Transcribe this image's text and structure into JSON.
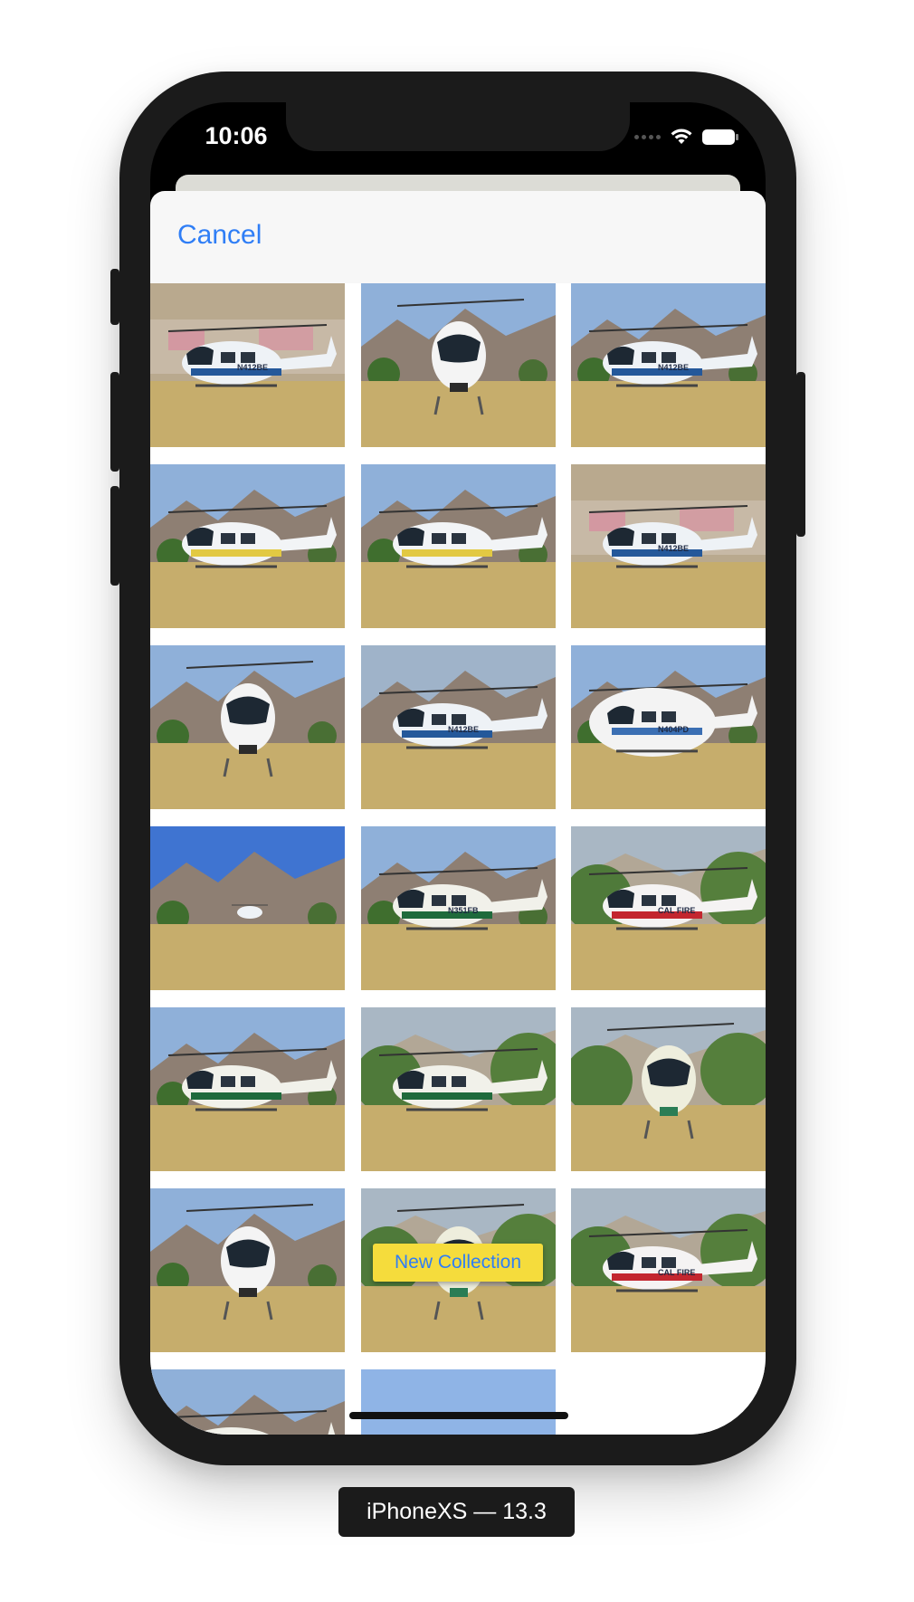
{
  "status_bar": {
    "time": "10:06",
    "icons": [
      "signal-dots-icon",
      "wifi-icon",
      "battery-icon"
    ]
  },
  "sheet": {
    "cancel_label": "Cancel"
  },
  "photos": [
    {
      "scene": "graffiti",
      "heli": "blue-white-side",
      "label": "N412BE"
    },
    {
      "scene": "mountain",
      "heli": "white-front",
      "label": ""
    },
    {
      "scene": "mountain",
      "heli": "blue-white-side",
      "label": "N412BE"
    },
    {
      "scene": "mountain",
      "heli": "white-yellow-side",
      "label": ""
    },
    {
      "scene": "mountain",
      "heli": "white-yellow-side",
      "label": ""
    },
    {
      "scene": "graffiti",
      "heli": "blue-white-side",
      "label": "N412BE"
    },
    {
      "scene": "mountain",
      "heli": "white-front",
      "label": ""
    },
    {
      "scene": "dusty",
      "heli": "blue-white-side",
      "label": "N412BE"
    },
    {
      "scene": "mountain",
      "heli": "white-side-large",
      "label": "N404PD"
    },
    {
      "scene": "open-field",
      "heli": "small-distant",
      "label": ""
    },
    {
      "scene": "mountain",
      "heli": "green-white-side",
      "label": "N351FB"
    },
    {
      "scene": "trees",
      "heli": "red-white-side",
      "label": "CAL FIRE"
    },
    {
      "scene": "mountain",
      "heli": "green-white-side",
      "label": ""
    },
    {
      "scene": "trees",
      "heli": "green-white-side",
      "label": ""
    },
    {
      "scene": "trees",
      "heli": "green-front",
      "label": ""
    },
    {
      "scene": "mountain",
      "heli": "white-front",
      "label": ""
    },
    {
      "scene": "trees",
      "heli": "green-front",
      "label": ""
    },
    {
      "scene": "trees",
      "heli": "red-white-side",
      "label": "CAL FIRE"
    },
    {
      "scene": "mountain",
      "heli": "green-white-side",
      "label": ""
    },
    {
      "scene": "sky",
      "heli": "none",
      "label": ""
    }
  ],
  "new_collection_label": "New Collection",
  "device_label": "iPhoneXS — 13.3",
  "colors": {
    "accent": "#2f7ef6",
    "button_bg": "#f5dc3c"
  }
}
